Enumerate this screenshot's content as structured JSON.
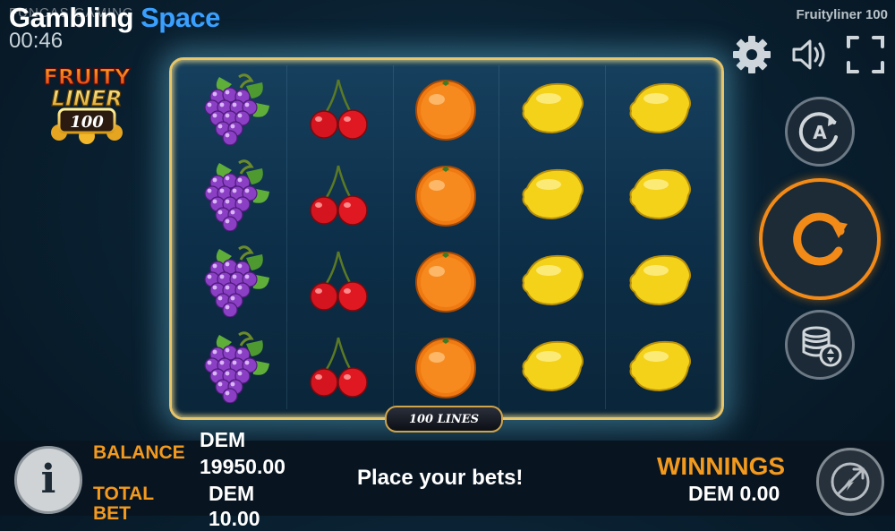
{
  "watermark": {
    "part1": "Gambling",
    "part2": "Space",
    "ghost": "FUNCAS GAMING"
  },
  "clock": "00:46",
  "game_title": "Fruityliner 100",
  "logo": {
    "line1": "FRUITY",
    "line2": "LINER",
    "line3": "100"
  },
  "icons": {
    "settings": "gear-icon",
    "sound": "speaker-icon",
    "fullscreen": "fullscreen-icon",
    "autoplay": "autoplay-icon",
    "spin": "spin-icon",
    "stake": "coin-stack-icon",
    "info": "info-icon",
    "gamble": "gamble-icon"
  },
  "autoplay_letter": "A",
  "reels": [
    [
      "grapes",
      "grapes",
      "grapes",
      "grapes"
    ],
    [
      "cherries",
      "cherries",
      "cherries",
      "cherries"
    ],
    [
      "orange",
      "orange",
      "orange",
      "orange"
    ],
    [
      "lemon",
      "lemon",
      "lemon",
      "lemon"
    ],
    [
      "lemon",
      "lemon",
      "lemon",
      "lemon"
    ]
  ],
  "lines_badge": "100 LINES",
  "bottom": {
    "balance_label": "BALANCE",
    "balance_currency": "DEM",
    "balance_amount": "19950.00",
    "bet_label": "TOTAL BET",
    "bet_currency": "DEM",
    "bet_amount": "10.00",
    "message": "Place your bets!",
    "winnings_label": "WINNINGS",
    "winnings_value": "DEM 0.00"
  },
  "colors": {
    "accent_orange": "#f39a1e",
    "frame_gold": "#e7c56a",
    "spin_ring": "#f28a18"
  }
}
